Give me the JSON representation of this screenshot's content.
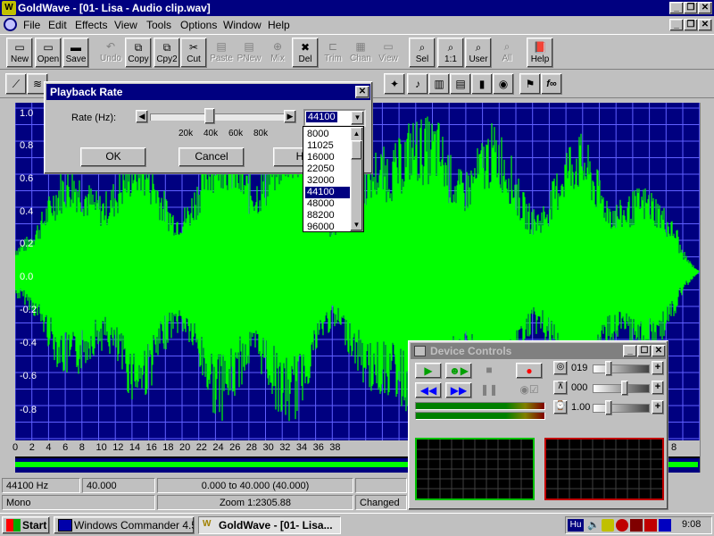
{
  "window": {
    "title": "GoldWave - [01- Lisa - Audio clip.wav]",
    "app_icon": "W"
  },
  "menu": [
    "File",
    "Edit",
    "Effects",
    "View",
    "Tools",
    "Options",
    "Window",
    "Help"
  ],
  "toolbar1": [
    {
      "label": "New",
      "icon": "new-file-icon",
      "glyph": "▭",
      "enabled": true
    },
    {
      "label": "Open",
      "icon": "open-icon",
      "glyph": "▭",
      "enabled": true
    },
    {
      "label": "Save",
      "icon": "save-icon",
      "glyph": "▬",
      "enabled": true
    },
    {
      "label": "Undo",
      "icon": "undo-icon",
      "glyph": "↶",
      "enabled": false
    },
    {
      "label": "Copy",
      "icon": "copy-icon",
      "glyph": "⧉",
      "enabled": true
    },
    {
      "label": "Cpy2",
      "icon": "copy2-icon",
      "glyph": "⧉",
      "enabled": true
    },
    {
      "label": "Cut",
      "icon": "cut-icon",
      "glyph": "✂",
      "enabled": true
    },
    {
      "label": "Paste",
      "icon": "paste-icon",
      "glyph": "▤",
      "enabled": false
    },
    {
      "label": "PNew",
      "icon": "paste-new-icon",
      "glyph": "▤",
      "enabled": false
    },
    {
      "label": "Mix",
      "icon": "mix-icon",
      "glyph": "⊕",
      "enabled": false
    },
    {
      "label": "Del",
      "icon": "delete-icon",
      "glyph": "✖",
      "enabled": true
    },
    {
      "label": "Trim",
      "icon": "trim-icon",
      "glyph": "⊏",
      "enabled": false
    },
    {
      "label": "Chan",
      "icon": "channel-icon",
      "glyph": "▦",
      "enabled": false
    },
    {
      "label": "View",
      "icon": "view-icon",
      "glyph": "▭",
      "enabled": false
    },
    {
      "label": "Sel",
      "icon": "select-icon",
      "glyph": "⌕",
      "enabled": true
    },
    {
      "label": "1:1",
      "icon": "zoom-1-1-icon",
      "glyph": "⌕",
      "enabled": true
    },
    {
      "label": "User",
      "icon": "user-zoom-icon",
      "glyph": "⌕",
      "enabled": true
    },
    {
      "label": "All",
      "icon": "zoom-all-icon",
      "glyph": "⌕",
      "enabled": false
    },
    {
      "label": "Help",
      "icon": "help-book-icon",
      "glyph": "📕",
      "enabled": true
    }
  ],
  "dialog": {
    "title": "Playback Rate",
    "rate_label": "Rate (Hz):",
    "ticks": [
      "20k",
      "40k",
      "60k",
      "80k"
    ],
    "rate_value": "44100",
    "slider_fraction": 0.44,
    "ok": "OK",
    "cancel": "Cancel",
    "help": "H",
    "options": [
      "8000",
      "11025",
      "16000",
      "22050",
      "32000",
      "44100",
      "48000",
      "88200",
      "96000"
    ],
    "selected_option": "44100"
  },
  "y_axis": [
    "1.0",
    "0.8",
    "0.6",
    "0.4",
    "0.2",
    "0.0",
    "-0.2",
    "-0.4",
    "-0.6",
    "-0.8"
  ],
  "x_axis": [
    "0",
    "2",
    "4",
    "6",
    "8",
    "10",
    "12",
    "14",
    "16",
    "18",
    "20",
    "22",
    "24",
    "26",
    "28",
    "30",
    "32",
    "34",
    "36",
    "38"
  ],
  "x_axis_visible_right": "8",
  "status": {
    "rate": "44100 Hz",
    "length": "40.000",
    "range": "0.000 to 40.000 (40.000)",
    "channels": "Mono",
    "zoom": "Zoom 1:2305.88",
    "state": "Changed"
  },
  "device": {
    "title": "Device Controls",
    "vol_value": "019",
    "bal_value": "000",
    "speed_value": "1.00"
  },
  "taskbar": {
    "start": "Start",
    "task1": "Windows Commander 4.51...",
    "task2": "GoldWave - [01- Lisa...",
    "lang": "Hu",
    "clock": "9:08"
  },
  "colors": {
    "wave_bg": "#000080",
    "wave": "#00ff00",
    "grid": "#6060ff",
    "titlebar": "#000080"
  }
}
